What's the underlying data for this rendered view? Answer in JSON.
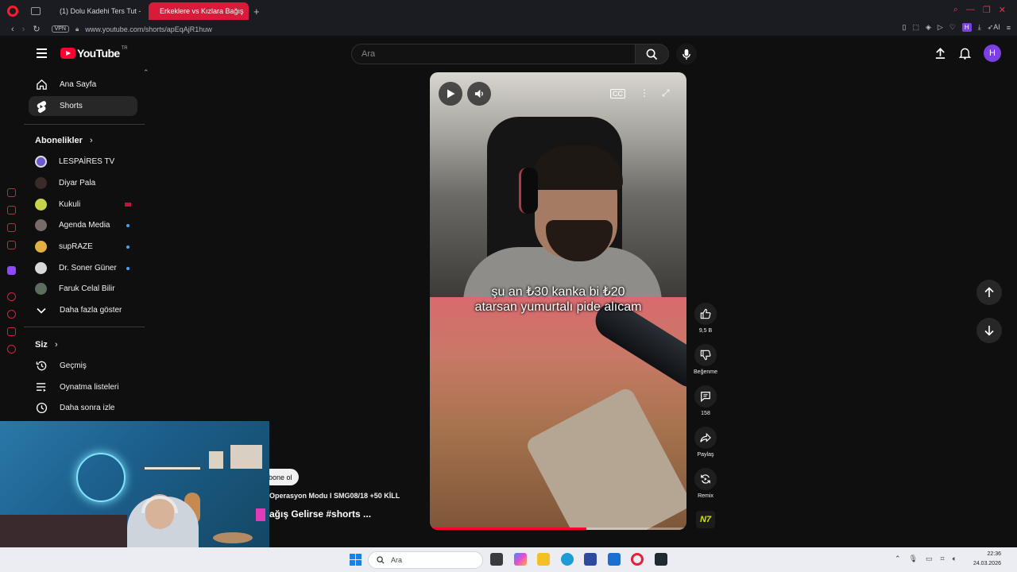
{
  "browser": {
    "tabs": [
      {
        "label": "(1) Dolu Kadehi Ters Tut -"
      },
      {
        "label": "Erkeklere vs Kızlara Bağış"
      }
    ],
    "new_tab": "+",
    "vpn": "VPN",
    "url": "www.youtube.com/shorts/apEqAjR1huw",
    "profile_badge": "H",
    "ai_label": "AI"
  },
  "masthead": {
    "logo_text": "YouTube",
    "country": "TR",
    "search_placeholder": "Ara",
    "avatar_letter": "H"
  },
  "sidebar": {
    "main": [
      {
        "label": "Ana Sayfa",
        "icon": "home-icon"
      },
      {
        "label": "Shorts",
        "icon": "shorts-icon",
        "active": true
      }
    ],
    "subscriptions_title": "Abonelikler",
    "subscriptions": [
      {
        "label": "LESPAİRES TV",
        "color": "#6a5acd"
      },
      {
        "label": "Diyar Pala",
        "color": "#333333"
      },
      {
        "label": "Kukuli",
        "color": "#c8d44a"
      },
      {
        "label": "Agenda Media",
        "color": "#7a6b6b"
      },
      {
        "label": "supRAZE",
        "color": "#e0b040"
      },
      {
        "label": "Dr. Soner Güner",
        "color": "#d9d9d9"
      },
      {
        "label": "Faruk Celal Bilir",
        "color": "#5e6e5e"
      }
    ],
    "show_more": "Daha fazla göster",
    "you_title": "Siz",
    "you_items": [
      {
        "label": "Geçmiş",
        "icon": "history-icon"
      },
      {
        "label": "Oynatma listeleri",
        "icon": "playlists-icon"
      },
      {
        "label": "Daha sonra izle",
        "icon": "clock-icon"
      }
    ]
  },
  "player": {
    "caption_line1": "şu an ₺30 kanka bi ₺20",
    "caption_line2": "atarsan yumurtalı pide alıcam",
    "progress": 0.61
  },
  "actions": {
    "like_count": "9,5 B",
    "dislike_label": "Beğenme",
    "comment_count": "158",
    "share_label": "Paylaş",
    "remix_label": "Remix",
    "sound_badge": "N7"
  },
  "overlay": {
    "subscribe": "bone ol",
    "description": "Operasyon Modu I SMG08/18 +50 KİLL",
    "title": "ağış Gelirse #shorts ..."
  },
  "taskbar": {
    "search_placeholder": "Ara",
    "time": "22:36",
    "date": "24.03.2026"
  },
  "colors": {
    "accent": "#ff0033",
    "opera_red": "#d81b3a",
    "background": "#0f0f0f"
  }
}
